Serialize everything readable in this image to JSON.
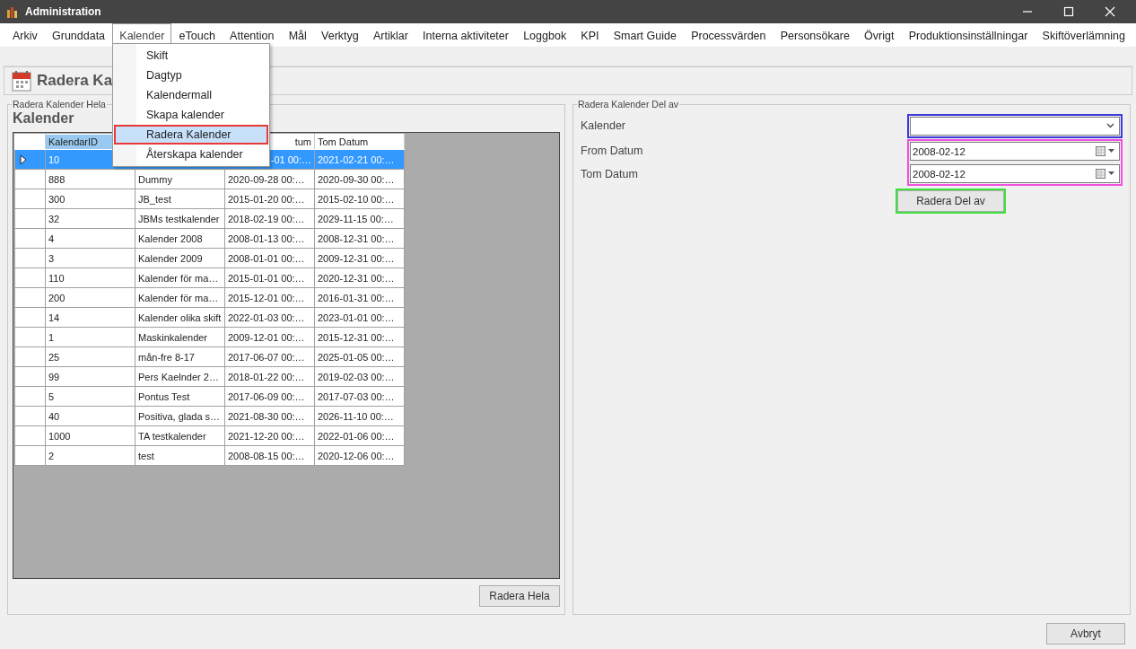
{
  "window": {
    "title": "Administration"
  },
  "menu": [
    {
      "label": "Arkiv",
      "selected": false
    },
    {
      "label": "Grunddata",
      "selected": false
    },
    {
      "label": "Kalender",
      "selected": true
    },
    {
      "label": "eTouch",
      "selected": false
    },
    {
      "label": "Attention",
      "selected": false
    },
    {
      "label": "Mål",
      "selected": false
    },
    {
      "label": "Verktyg",
      "selected": false
    },
    {
      "label": "Artiklar",
      "selected": false
    },
    {
      "label": "Interna aktiviteter",
      "selected": false
    },
    {
      "label": "Loggbok",
      "selected": false
    },
    {
      "label": "KPI",
      "selected": false
    },
    {
      "label": "Smart Guide",
      "selected": false
    },
    {
      "label": "Processvärden",
      "selected": false
    },
    {
      "label": "Personsökare",
      "selected": false
    },
    {
      "label": "Övrigt",
      "selected": false
    },
    {
      "label": "Produktionsinställningar",
      "selected": false
    },
    {
      "label": "Skiftöverlämning",
      "selected": false
    }
  ],
  "dropdown": [
    {
      "label": "Skift",
      "selected": false
    },
    {
      "label": "Dagtyp",
      "selected": false
    },
    {
      "label": "Kalendermall",
      "selected": false
    },
    {
      "label": "Skapa kalender",
      "selected": false
    },
    {
      "label": "Radera Kalender",
      "selected": true,
      "color": "#e8383a"
    },
    {
      "label": "Återskapa kalender",
      "selected": false
    }
  ],
  "header": {
    "title": "Radera Ka"
  },
  "left_panel": {
    "legend": "Radera Kalender Hela",
    "heading": "Kalender",
    "table": {
      "columns": [
        {
          "label": "KalendarID",
          "selected": true
        },
        {},
        {
          "label": "tum",
          "selected": false
        },
        {
          "label": "Tom Datum",
          "selected": false
        }
      ],
      "rows": [
        {
          "cells": [
            "10",
            "",
            "-01 00:…",
            "2021-02-21 00:…"
          ],
          "selected": true,
          "clipped": true
        },
        {
          "cells": [
            "888",
            "Dummy",
            "2020-09-28 00:…",
            "2020-09-30 00:…"
          ],
          "selected": false
        },
        {
          "cells": [
            "300",
            "JB_test",
            "2015-01-20 00:…",
            "2015-02-10 00:…"
          ],
          "selected": false
        },
        {
          "cells": [
            "32",
            "JBMs testkalender",
            "2018-02-19 00:…",
            "2029-11-15 00:…"
          ],
          "selected": false
        },
        {
          "cells": [
            "4",
            "Kalender 2008",
            "2008-01-13 00:…",
            "2008-12-31 00:…"
          ],
          "selected": false
        },
        {
          "cells": [
            "3",
            "Kalender 2009",
            "2008-01-01 00:…",
            "2009-12-31 00:…"
          ],
          "selected": false
        },
        {
          "cells": [
            "110",
            "Kalender för ma…",
            "2015-01-01 00:…",
            "2020-12-31 00:…"
          ],
          "selected": false
        },
        {
          "cells": [
            "200",
            "Kalender för ma…",
            "2015-12-01 00:…",
            "2016-01-31 00:…"
          ],
          "selected": false
        },
        {
          "cells": [
            "14",
            "Kalender olika skift",
            "2022-01-03 00:…",
            "2023-01-01 00:…"
          ],
          "selected": false
        },
        {
          "cells": [
            "1",
            "Maskinkalender",
            "2009-12-01 00:…",
            "2015-12-31 00:…"
          ],
          "selected": false
        },
        {
          "cells": [
            "25",
            "mån-fre 8-17",
            "2017-06-07 00:…",
            "2025-01-05 00:…"
          ],
          "selected": false
        },
        {
          "cells": [
            "99",
            "Pers Kaelnder 2…",
            "2018-01-22 00:…",
            "2019-02-03 00:…"
          ],
          "selected": false
        },
        {
          "cells": [
            "5",
            "Pontus Test",
            "2017-06-09 00:…",
            "2017-07-03 00:…"
          ],
          "selected": false
        },
        {
          "cells": [
            "40",
            "Positiva, glada s…",
            "2021-08-30 00:…",
            "2026-11-10 00:…"
          ],
          "selected": false
        },
        {
          "cells": [
            "1000",
            "TA testkalender",
            "2021-12-20 00:…",
            "2022-01-06 00:…"
          ],
          "selected": false
        },
        {
          "cells": [
            "2",
            "test",
            "2008-08-15 00:…",
            "2020-12-06 00:…"
          ],
          "selected": false
        }
      ]
    },
    "button": "Radera Hela"
  },
  "right_panel": {
    "legend": "Radera Kalender Del av",
    "calendar": {
      "label": "Kalender",
      "color": "#3b3bdc"
    },
    "dates": {
      "color": "#f04fe0",
      "fields": [
        {
          "label": "From Datum",
          "value": "2008-02-12"
        },
        {
          "label": "Tom Datum",
          "value": "2008-02-12"
        }
      ]
    },
    "button": {
      "label": "Radera Del av",
      "color": "#3ee03e"
    }
  },
  "footer": {
    "button": "Avbryt"
  }
}
